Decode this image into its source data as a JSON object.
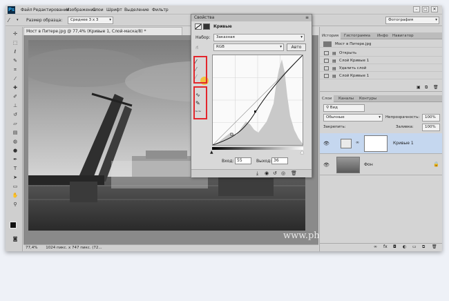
{
  "app": {
    "logo": "Ps"
  },
  "menu": [
    "Файл",
    "Редактирование",
    "Изображение",
    "Слои",
    "Шрифт",
    "Выделение",
    "Фильтр"
  ],
  "workspace": "Фотография",
  "window_buttons": [
    "–",
    "□",
    "✕"
  ],
  "options": {
    "sample_label": "Размер образца:",
    "sample_value": "Среднее 3 x 3"
  },
  "document": {
    "tab_title": "Мост в Питере.jpg @ 77,4% (Кривые 1, Слой-маска/8) *",
    "zoom": "77,4%",
    "doc_info": "1024 пикс. x 747 пикс. (72..."
  },
  "properties": {
    "title": "Свойства",
    "adjustment_name": "Кривые",
    "preset_label": "Набор:",
    "preset_value": "Заказная",
    "channel_value": "RGB",
    "auto_button": "Авто",
    "input_label": "Вход:",
    "input_value": "55",
    "output_label": "Выход:",
    "output_value": "36"
  },
  "history": {
    "tabs": [
      "История",
      "Гистограмма",
      "Инфо",
      "Навигатор"
    ],
    "snapshot": "Мост в Питере.jpg",
    "items": [
      "Открыть",
      "Слой Кривые 1",
      "Удалить слой",
      "Слой Кривые 1"
    ]
  },
  "layers": {
    "tabs": [
      "Слои",
      "Каналы",
      "Контуры"
    ],
    "filter_value": "Вид",
    "blend_mode": "Обычные",
    "opacity_label": "Непрозрачность:",
    "opacity_value": "100%",
    "lock_label": "Закрепить:",
    "fill_label": "Заливка:",
    "fill_value": "100%",
    "items": [
      {
        "name": "Кривые 1"
      },
      {
        "name": "Фон"
      }
    ]
  },
  "watermark": "www.photoshopsunduchok.ru",
  "colors": {
    "highlight": "#e3262c",
    "selected_layer": "#c5d7ef"
  }
}
